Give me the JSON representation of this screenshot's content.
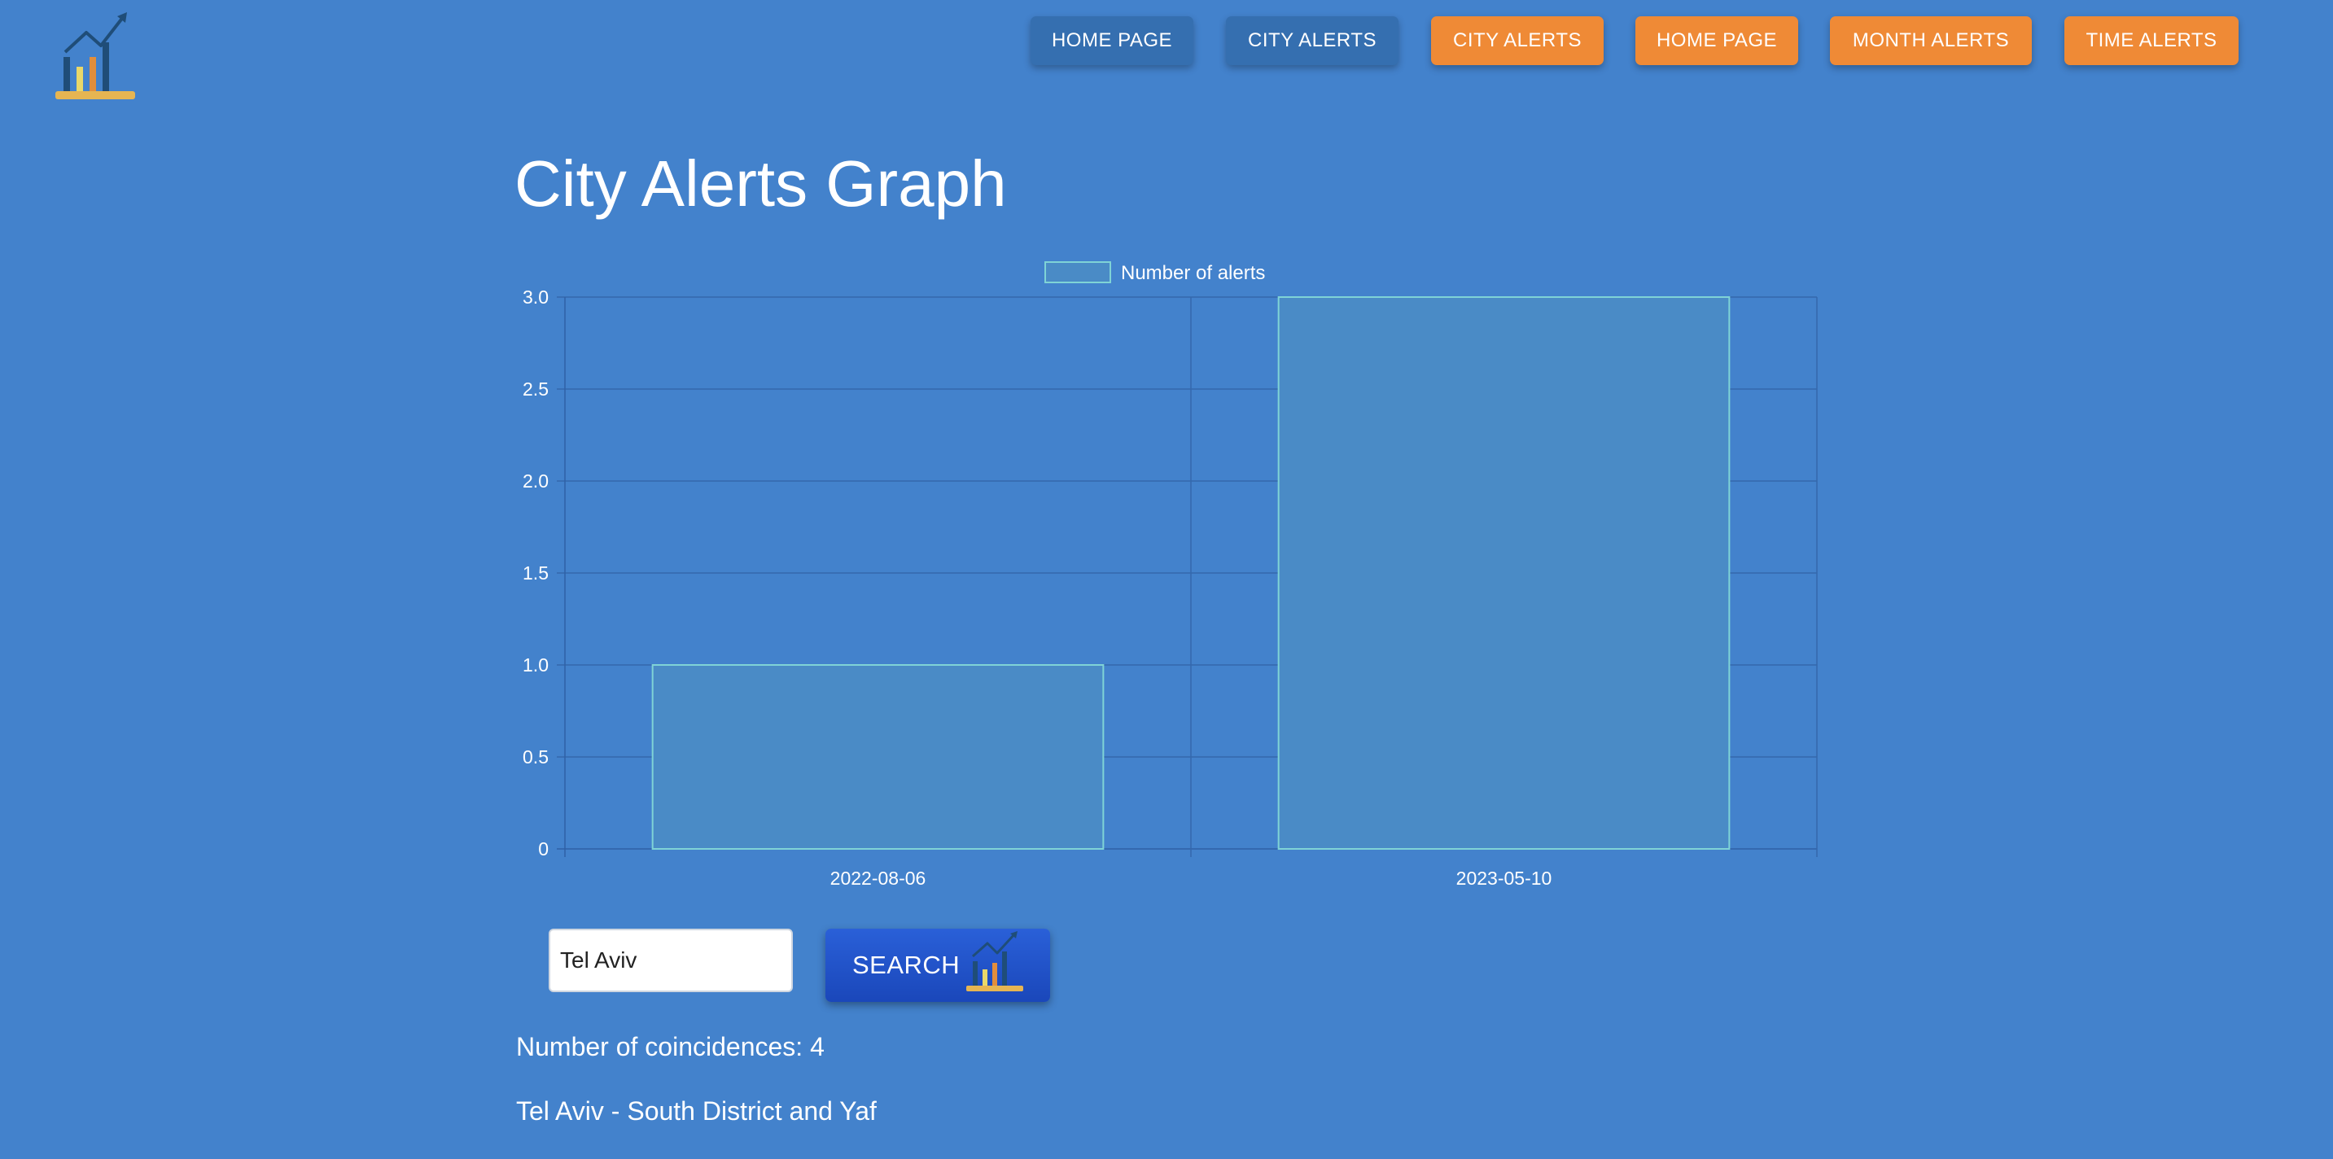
{
  "nav": {
    "buttons": [
      {
        "label": "HOME PAGE",
        "style": "blue"
      },
      {
        "label": "CITY ALERTS",
        "style": "blue"
      },
      {
        "label": "CITY ALERTS",
        "style": "orange"
      },
      {
        "label": "HOME PAGE",
        "style": "orange"
      },
      {
        "label": "MONTH ALERTS",
        "style": "orange"
      },
      {
        "label": "TIME ALERTS",
        "style": "orange"
      }
    ]
  },
  "page": {
    "title": "City Alerts Graph"
  },
  "chart_data": {
    "type": "bar",
    "categories": [
      "2022-08-06",
      "2023-05-10"
    ],
    "series": [
      {
        "name": "Number of alerts",
        "values": [
          1,
          3
        ]
      }
    ],
    "title": "",
    "xlabel": "",
    "ylabel": "",
    "ylim": [
      0,
      3
    ],
    "yticks": [
      "0",
      "0.5",
      "1.0",
      "1.5",
      "2.0",
      "2.5",
      "3.0"
    ],
    "grid": true,
    "legend": "top-center",
    "bar_fill": "#4a8bc6",
    "bar_stroke": "#7fd3d6"
  },
  "search": {
    "value": "Tel Aviv",
    "button_label": "SEARCH"
  },
  "results": {
    "count_text": "Number of coincidences: 4",
    "city_text": "Tel Aviv - South District and Yaf"
  },
  "colors": {
    "background": "#4382cc",
    "nav_blue": "#356fb0",
    "nav_orange": "#ef8a36",
    "search_button": "#1f4fc6"
  }
}
